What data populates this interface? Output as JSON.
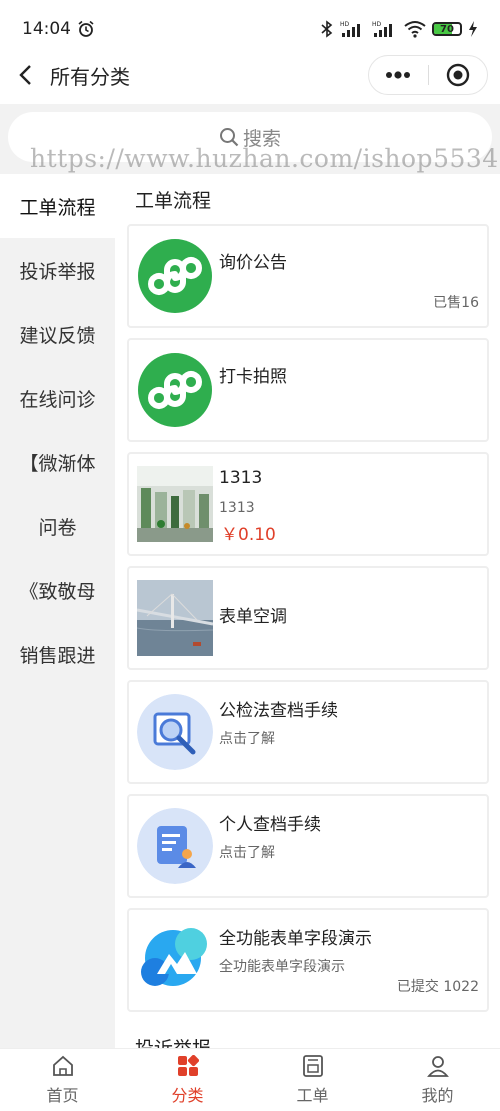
{
  "status": {
    "time": "14:04",
    "battery": "70",
    "battery_level": 0.7
  },
  "nav": {
    "title": "所有分类"
  },
  "search": {
    "placeholder": "搜索"
  },
  "watermark": "https://www.huzhan.com/ishop5534",
  "sidebar": {
    "items": [
      {
        "label": "工单流程"
      },
      {
        "label": "投诉举报"
      },
      {
        "label": "建议反馈"
      },
      {
        "label": "在线问诊"
      },
      {
        "label": "【微渐体"
      },
      {
        "label": "问卷"
      },
      {
        "label": "《致敬母"
      },
      {
        "label": "销售跟进"
      }
    ]
  },
  "content": {
    "section1": "工单流程",
    "section2": "投诉举报",
    "cards": [
      {
        "title": "询价公告",
        "right": "已售16"
      },
      {
        "title": "打卡拍照"
      },
      {
        "title": "1313",
        "subtitle": "1313",
        "price": "￥0.10"
      },
      {
        "title": "表单空调"
      },
      {
        "title": "公检法查档手续",
        "subtitle": "点击了解"
      },
      {
        "title": "个人查档手续",
        "subtitle": "点击了解"
      },
      {
        "title": "全功能表单字段演示",
        "subtitle": "全功能表单字段演示",
        "right": "已提交 1022"
      }
    ]
  },
  "tabs": [
    {
      "label": "首页",
      "icon": "home-icon"
    },
    {
      "label": "分类",
      "icon": "category-icon"
    },
    {
      "label": "工单",
      "icon": "workorder-icon"
    },
    {
      "label": "我的",
      "icon": "profile-icon"
    }
  ],
  "colors": {
    "accent": "#e0402a",
    "miniprogram_green": "#2fae4e",
    "sidebar_bg": "#f2f2f2"
  }
}
